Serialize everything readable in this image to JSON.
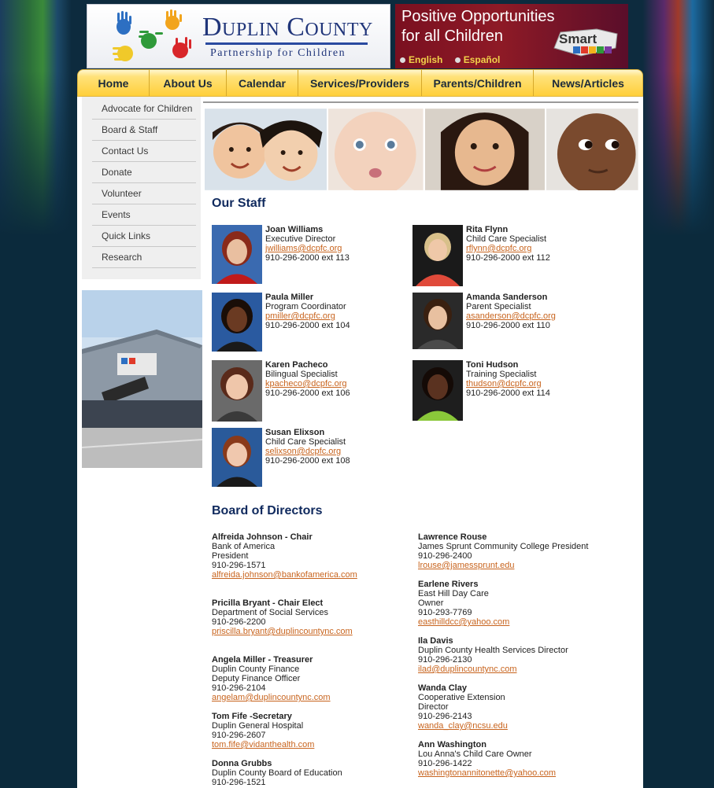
{
  "header": {
    "logo_title": "Duplin County",
    "logo_subtitle": "Partnership for Children",
    "tagline_line1": "Positive Opportunities",
    "tagline_line2": "for all Children",
    "lang_english": "English",
    "lang_spanish": "Español",
    "smart_logo_text": "Smart Start"
  },
  "nav": [
    "Home",
    "About Us",
    "Calendar",
    "Services/Providers",
    "Parents/Children",
    "News/Articles"
  ],
  "sidebar": [
    "Advocate for Children",
    "Board & Staff",
    "Contact Us",
    "Donate",
    "Volunteer",
    "Events",
    "Quick Links",
    "Research"
  ],
  "staff_title": "Our Staff",
  "staff": [
    {
      "name": "Joan Williams",
      "title": "Executive Director",
      "email": "jwilliams@dcpfc.org",
      "phone": "910-296-2000 ext 113"
    },
    {
      "name": "Rita Flynn",
      "title": "Child Care Specialist",
      "email": "rflynn@dcpfc.org",
      "phone": "910-296-2000 ext 112"
    },
    {
      "name": "Paula Miller",
      "title": "Program Coordinator",
      "email": "pmiller@dcpfc.org",
      "phone": "910-296-2000 ext 104"
    },
    {
      "name": "Amanda Sanderson",
      "title": "Parent Specialist",
      "email": "asanderson@dcpfc.org",
      "phone": "910-296-2000 ext 110"
    },
    {
      "name": "Karen Pacheco",
      "title": "Bilingual Specialist",
      "email": "kpacheco@dcpfc.org",
      "phone": "910-296-2000 ext 106"
    },
    {
      "name": "Toni Hudson",
      "title": "Training Specialist",
      "email": "thudson@dcpfc.org",
      "phone": "910-296-2000 ext 114"
    },
    {
      "name": "Susan Elixson",
      "title": "Child Care Specialist",
      "email": "selixson@dcpfc.org",
      "phone": "910-296-2000 ext 108"
    }
  ],
  "board_title": "Board of Directors",
  "board_left": [
    {
      "name": "Alfreida Johnson - Chair",
      "lines": [
        "Bank of America",
        "President",
        "910-296-1571"
      ],
      "email": "alfreida.johnson@bankofamerica.com"
    },
    {
      "name": "Pricilla Bryant - Chair Elect",
      "lines": [
        "Department of Social Services",
        "910-296-2200"
      ],
      "email": "priscilla.bryant@duplincountync.com"
    },
    {
      "name": "Angela Miller - Treasurer",
      "lines": [
        "Duplin County Finance",
        "Deputy Finance Officer",
        "910-296-2104"
      ],
      "email": "angelam@duplincountync.com"
    },
    {
      "name": "Tom Fife -Secretary",
      "lines": [
        "Duplin General Hospital",
        "910-296-2607"
      ],
      "email": "tom.fife@vidanthealth.com"
    },
    {
      "name": "Donna Grubbs",
      "lines": [
        "Duplin County Board of Education",
        "910-296-1521"
      ],
      "email": ""
    }
  ],
  "board_right": [
    {
      "name": "Lawrence Rouse",
      "lines": [
        "James Sprunt Community College President",
        "910-296-2400"
      ],
      "email": "lrouse@jamessprunt.edu"
    },
    {
      "name": "Earlene Rivers",
      "lines": [
        "East Hill Day Care",
        "Owner",
        "910-293-7769"
      ],
      "email": "easthilldcc@yahoo.com"
    },
    {
      "name": "Ila Davis",
      "lines": [
        "Duplin County Health Services Director",
        "910-296-2130"
      ],
      "email": "ilad@duplincountync.com"
    },
    {
      "name": "Wanda Clay",
      "lines": [
        "Cooperative Extension",
        "Director",
        "910-296-2143"
      ],
      "email": "wanda_clay@ncsu.edu"
    },
    {
      "name": "Ann Washington",
      "lines": [
        "Lou Anna's Child Care Owner",
        "910-296-1422"
      ],
      "email": "washingtonannitonette@yahoo.com"
    }
  ]
}
